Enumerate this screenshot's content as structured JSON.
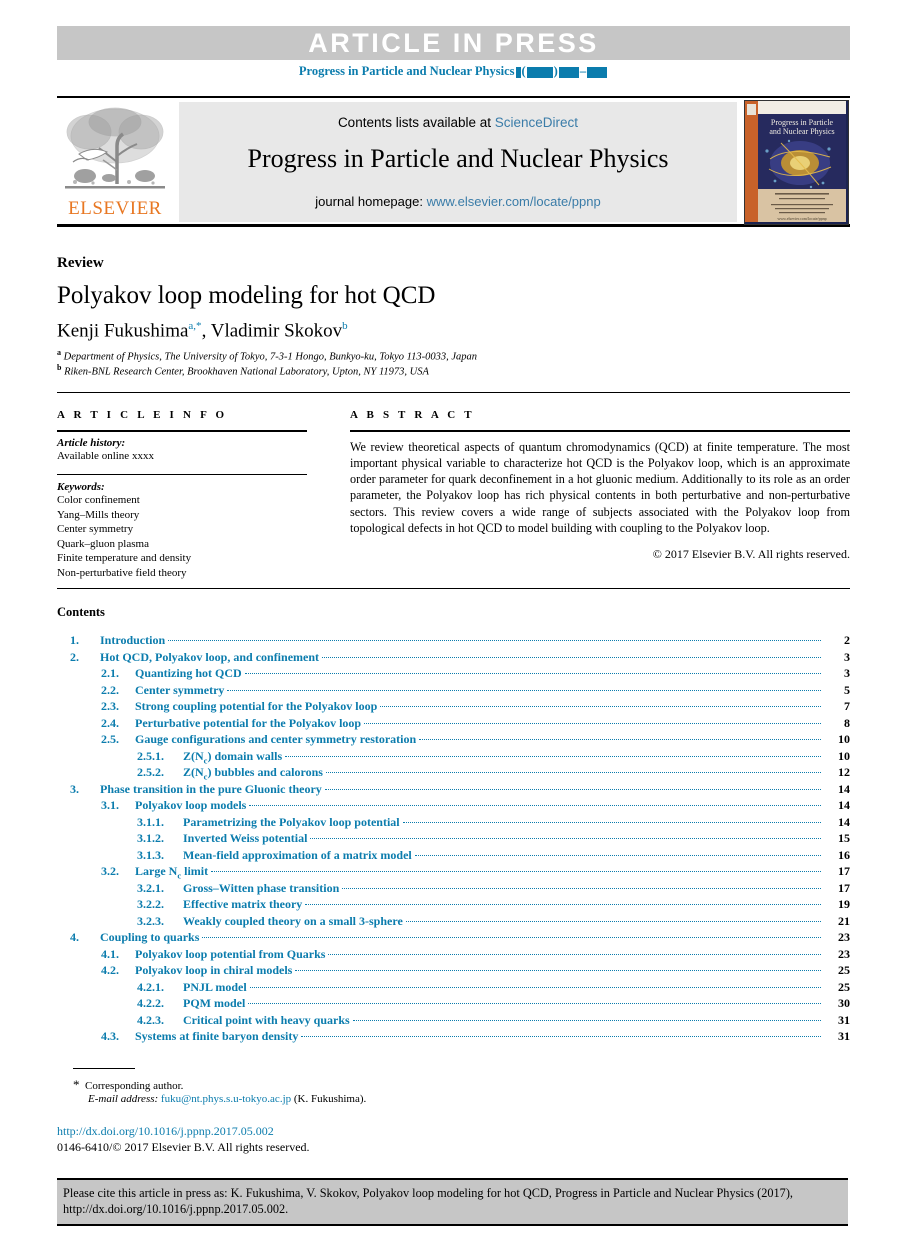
{
  "header": {
    "press_banner": "ARTICLE IN PRESS",
    "journal_running": "Progress in Particle and Nuclear Physics"
  },
  "masthead": {
    "contents_line": "Contents lists available at ",
    "sciencedirect": "ScienceDirect",
    "journal_title": "Progress in Particle and Nuclear Physics",
    "homepage_label": "journal homepage: ",
    "homepage_url": "www.elsevier.com/locate/ppnp",
    "publisher": "ELSEVIER",
    "cover_title": "Progress in Particle and Nuclear Physics"
  },
  "article": {
    "kicker": "Review",
    "title": "Polyakov loop modeling for hot QCD",
    "author_1": "Kenji Fukushima",
    "author_1_marks": "a,*",
    "author_2": "Vladimir Skokov",
    "author_2_marks": "b",
    "affiliation_a_mark": "a",
    "affiliation_a": "Department of Physics, The University of Tokyo, 7-3-1 Hongo, Bunkyo-ku, Tokyo 113-0033, Japan",
    "affiliation_b_mark": "b",
    "affiliation_b": "Riken-BNL Research Center, Brookhaven National Laboratory, Upton, NY 11973, USA"
  },
  "info": {
    "header": "A R T I C L E   I N F O",
    "history_label": "Article history:",
    "history_value": "Available online xxxx",
    "keywords_label": "Keywords:",
    "keywords": [
      "Color confinement",
      "Yang–Mills theory",
      "Center symmetry",
      "Quark–gluon plasma",
      "Finite temperature and density",
      "Non-perturbative field theory"
    ]
  },
  "abstract": {
    "header": "A B S T R A C T",
    "text": "We review theoretical aspects of quantum chromodynamics (QCD) at finite temperature. The most important physical variable to characterize hot QCD is the Polyakov loop, which is an approximate order parameter for quark deconfinement in a hot gluonic medium. Additionally to its role as an order parameter, the Polyakov loop has rich physical contents in both perturbative and non-perturbative sectors. This review covers a wide range of subjects associated with the Polyakov loop from topological defects in hot QCD to model building with coupling to the Polyakov loop.",
    "copyright": "© 2017 Elsevier B.V. All rights reserved."
  },
  "contents": {
    "header": "Contents",
    "entries": [
      {
        "level": 1,
        "num": "1.",
        "label": "Introduction",
        "page": "2"
      },
      {
        "level": 1,
        "num": "2.",
        "label": "Hot QCD, Polyakov loop, and confinement",
        "page": "3"
      },
      {
        "level": 2,
        "num": "2.1.",
        "label": "Quantizing hot QCD",
        "page": "3"
      },
      {
        "level": 2,
        "num": "2.2.",
        "label": "Center symmetry",
        "page": "5"
      },
      {
        "level": 2,
        "num": "2.3.",
        "label": "Strong coupling potential for the Polyakov loop",
        "page": "7"
      },
      {
        "level": 2,
        "num": "2.4.",
        "label": "Perturbative potential for the Polyakov loop",
        "page": "8"
      },
      {
        "level": 2,
        "num": "2.5.",
        "label": "Gauge configurations and center symmetry restoration",
        "page": "10"
      },
      {
        "level": 3,
        "num": "2.5.1.",
        "label": "Z(Nc) domain walls",
        "page": "10",
        "sub": "c",
        "pre": "Z(N",
        "post": ") domain walls"
      },
      {
        "level": 3,
        "num": "2.5.2.",
        "label": "Z(Nc) bubbles and calorons",
        "page": "12",
        "sub": "c",
        "pre": "Z(N",
        "post": ") bubbles and calorons"
      },
      {
        "level": 1,
        "num": "3.",
        "label": "Phase transition in the pure Gluonic theory",
        "page": "14"
      },
      {
        "level": 2,
        "num": "3.1.",
        "label": "Polyakov loop models",
        "page": "14"
      },
      {
        "level": 3,
        "num": "3.1.1.",
        "label": "Parametrizing the Polyakov loop potential",
        "page": "14"
      },
      {
        "level": 3,
        "num": "3.1.2.",
        "label": "Inverted Weiss potential",
        "page": "15"
      },
      {
        "level": 3,
        "num": "3.1.3.",
        "label": "Mean-field approximation of a matrix model",
        "page": "16"
      },
      {
        "level": 2,
        "num": "3.2.",
        "label": "Large Nc limit",
        "page": "17",
        "sub": "c",
        "pre": "Large N",
        "post": " limit"
      },
      {
        "level": 3,
        "num": "3.2.1.",
        "label": "Gross–Witten phase transition",
        "page": "17"
      },
      {
        "level": 3,
        "num": "3.2.2.",
        "label": "Effective matrix theory",
        "page": "19"
      },
      {
        "level": 3,
        "num": "3.2.3.",
        "label": "Weakly coupled theory on a small 3-sphere",
        "page": "21"
      },
      {
        "level": 1,
        "num": "4.",
        "label": "Coupling to quarks",
        "page": "23"
      },
      {
        "level": 2,
        "num": "4.1.",
        "label": "Polyakov loop potential from Quarks",
        "page": "23"
      },
      {
        "level": 2,
        "num": "4.2.",
        "label": "Polyakov loop in chiral models",
        "page": "25"
      },
      {
        "level": 3,
        "num": "4.2.1.",
        "label": "PNJL model",
        "page": "25"
      },
      {
        "level": 3,
        "num": "4.2.2.",
        "label": "PQM model",
        "page": "30"
      },
      {
        "level": 3,
        "num": "4.2.3.",
        "label": "Critical point with heavy quarks",
        "page": "31"
      },
      {
        "level": 2,
        "num": "4.3.",
        "label": "Systems at finite baryon density",
        "page": "31"
      }
    ]
  },
  "footnotes": {
    "corresponding": "Corresponding author.",
    "email_label": "E-mail address:",
    "email": "fuku@nt.phys.s.u-tokyo.ac.jp",
    "email_owner": "(K. Fukushima).",
    "doi": "http://dx.doi.org/10.1016/j.ppnp.2017.05.002",
    "issn": "0146-6410/© 2017 Elsevier B.V. All rights reserved."
  },
  "cite_box": {
    "line1": "Please cite this article in press as: K. Fukushima, V. Skokov, Polyakov loop modeling for hot QCD, Progress in Particle and Nuclear Physics (2017),",
    "line2": "http://dx.doi.org/10.1016/j.ppnp.2017.05.002."
  },
  "colors": {
    "link_blue": "#0b7cad",
    "sd_blue": "#3a7ca8",
    "banner_gray": "#c6c6c6",
    "box_gray": "#e8e8e8",
    "elsevier_orange": "#e87722"
  }
}
